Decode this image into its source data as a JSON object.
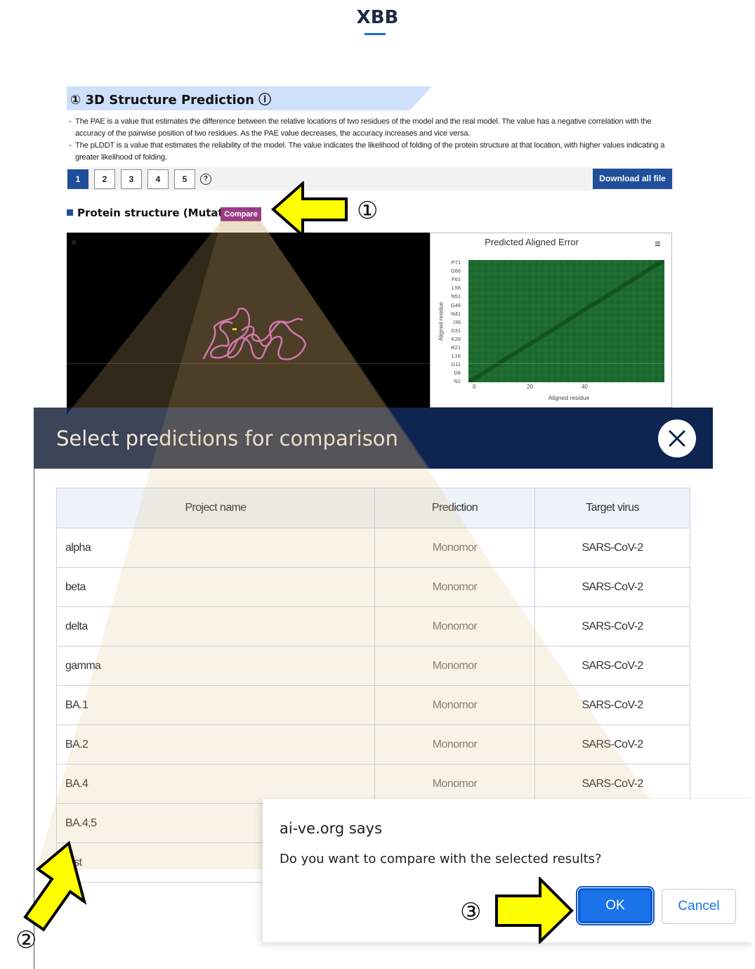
{
  "page": {
    "title": "XBB"
  },
  "section": {
    "title": "① 3D Structure Prediction ⓘ",
    "descriptions": [
      "The PAE is a value that estimates the difference between the relative locations of two residues of the model and the real model. The value has a negative correlation with the accuracy of the pairwise position of two residues. As the PAE value decreases, the accuracy increases and vice versa.",
      "The pLDDT is a value that estimates the reliability of the model. The value indicates the likelihood of folding of the protein structure at that location, with higher values indicating a greater likelihood of folding."
    ],
    "dash": "-"
  },
  "pager": {
    "pages": [
      "1",
      "2",
      "3",
      "4",
      "5"
    ],
    "active_page": "1",
    "help": "?",
    "download_label": "Download all file"
  },
  "structure": {
    "title": "Protein structure (Mutation)",
    "compare_label": "Compare",
    "menu_glyph": "≡"
  },
  "pae": {
    "title": "Predicted Aligned Error",
    "menu_glyph": "≡",
    "ylabel": "Aligned residue",
    "xlabel": "Aligned residue",
    "yticks": [
      "P71",
      "G66",
      "F61",
      "L56",
      "N51",
      "G46",
      "N41",
      "I36",
      "D31",
      "K26",
      "R21",
      "L16",
      "G11",
      "D6",
      "N1"
    ],
    "xticks": [
      "0",
      "20",
      "40"
    ],
    "color": "#1d6a2e"
  },
  "modal": {
    "title": "Select predictions for comparison",
    "close": "✕",
    "columns": [
      "Project name",
      "Prediction",
      "Target virus"
    ],
    "rows": [
      {
        "project": "alpha",
        "prediction": "Monomor",
        "target": "SARS-CoV-2"
      },
      {
        "project": "beta",
        "prediction": "Monomor",
        "target": "SARS-CoV-2"
      },
      {
        "project": "delta",
        "prediction": "Monomor",
        "target": "SARS-CoV-2"
      },
      {
        "project": "gamma",
        "prediction": "Monomor",
        "target": "SARS-CoV-2"
      },
      {
        "project": "BA.1",
        "prediction": "Monomor",
        "target": "SARS-CoV-2"
      },
      {
        "project": "BA.2",
        "prediction": "Monomor",
        "target": "SARS-CoV-2"
      },
      {
        "project": "BA.4",
        "prediction": "Monomor",
        "target": "SARS-CoV-2"
      },
      {
        "project": "BA.4,5",
        "prediction": "",
        "target": ""
      },
      {
        "project": "test",
        "prediction": "",
        "target": ""
      }
    ]
  },
  "alert": {
    "title": "ai-ve.org says",
    "message": "Do you want to compare with the selected results?",
    "ok": "OK",
    "cancel": "Cancel"
  },
  "annotations": {
    "step1": "①",
    "step2": "②",
    "step3": "③",
    "arrow_color": "#ffff00"
  }
}
